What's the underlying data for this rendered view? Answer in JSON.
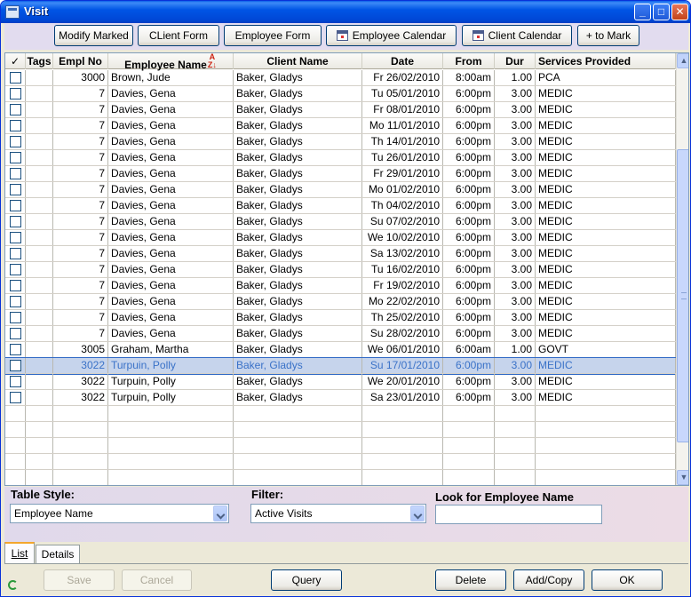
{
  "window": {
    "title": "Visit"
  },
  "toolbar": {
    "modify_marked": "Modify Marked",
    "client_form": "CLient Form",
    "employee_form": "Employee Form",
    "employee_calendar": "Employee Calendar",
    "client_calendar": "Client Calendar",
    "to_mark": "+ to Mark"
  },
  "table": {
    "headers": {
      "check": "✓",
      "tags": "Tags",
      "empl_no": "Empl No",
      "employee_name": "Employee Name",
      "client_name": "Client Name",
      "date": "Date",
      "from": "From",
      "dur": "Dur",
      "services": "Services Provided"
    },
    "rows": [
      {
        "empl": "3000",
        "employee": "Brown, Jude",
        "client": "Baker, Gladys",
        "date": "Fr 26/02/2010",
        "from": "8:00am",
        "dur": "1.00",
        "service": "PCA"
      },
      {
        "empl": "7",
        "employee": "Davies, Gena",
        "client": "Baker, Gladys",
        "date": "Tu 05/01/2010",
        "from": "6:00pm",
        "dur": "3.00",
        "service": "MEDIC"
      },
      {
        "empl": "7",
        "employee": "Davies, Gena",
        "client": "Baker, Gladys",
        "date": "Fr 08/01/2010",
        "from": "6:00pm",
        "dur": "3.00",
        "service": "MEDIC"
      },
      {
        "empl": "7",
        "employee": "Davies, Gena",
        "client": "Baker, Gladys",
        "date": "Mo 11/01/2010",
        "from": "6:00pm",
        "dur": "3.00",
        "service": "MEDIC"
      },
      {
        "empl": "7",
        "employee": "Davies, Gena",
        "client": "Baker, Gladys",
        "date": "Th 14/01/2010",
        "from": "6:00pm",
        "dur": "3.00",
        "service": "MEDIC"
      },
      {
        "empl": "7",
        "employee": "Davies, Gena",
        "client": "Baker, Gladys",
        "date": "Tu 26/01/2010",
        "from": "6:00pm",
        "dur": "3.00",
        "service": "MEDIC"
      },
      {
        "empl": "7",
        "employee": "Davies, Gena",
        "client": "Baker, Gladys",
        "date": "Fr 29/01/2010",
        "from": "6:00pm",
        "dur": "3.00",
        "service": "MEDIC"
      },
      {
        "empl": "7",
        "employee": "Davies, Gena",
        "client": "Baker, Gladys",
        "date": "Mo 01/02/2010",
        "from": "6:00pm",
        "dur": "3.00",
        "service": "MEDIC"
      },
      {
        "empl": "7",
        "employee": "Davies, Gena",
        "client": "Baker, Gladys",
        "date": "Th 04/02/2010",
        "from": "6:00pm",
        "dur": "3.00",
        "service": "MEDIC"
      },
      {
        "empl": "7",
        "employee": "Davies, Gena",
        "client": "Baker, Gladys",
        "date": "Su 07/02/2010",
        "from": "6:00pm",
        "dur": "3.00",
        "service": "MEDIC"
      },
      {
        "empl": "7",
        "employee": "Davies, Gena",
        "client": "Baker, Gladys",
        "date": "We 10/02/2010",
        "from": "6:00pm",
        "dur": "3.00",
        "service": "MEDIC"
      },
      {
        "empl": "7",
        "employee": "Davies, Gena",
        "client": "Baker, Gladys",
        "date": "Sa 13/02/2010",
        "from": "6:00pm",
        "dur": "3.00",
        "service": "MEDIC"
      },
      {
        "empl": "7",
        "employee": "Davies, Gena",
        "client": "Baker, Gladys",
        "date": "Tu 16/02/2010",
        "from": "6:00pm",
        "dur": "3.00",
        "service": "MEDIC"
      },
      {
        "empl": "7",
        "employee": "Davies, Gena",
        "client": "Baker, Gladys",
        "date": "Fr 19/02/2010",
        "from": "6:00pm",
        "dur": "3.00",
        "service": "MEDIC"
      },
      {
        "empl": "7",
        "employee": "Davies, Gena",
        "client": "Baker, Gladys",
        "date": "Mo 22/02/2010",
        "from": "6:00pm",
        "dur": "3.00",
        "service": "MEDIC"
      },
      {
        "empl": "7",
        "employee": "Davies, Gena",
        "client": "Baker, Gladys",
        "date": "Th 25/02/2010",
        "from": "6:00pm",
        "dur": "3.00",
        "service": "MEDIC"
      },
      {
        "empl": "7",
        "employee": "Davies, Gena",
        "client": "Baker, Gladys",
        "date": "Su 28/02/2010",
        "from": "6:00pm",
        "dur": "3.00",
        "service": "MEDIC"
      },
      {
        "empl": "3005",
        "employee": "Graham, Martha",
        "client": "Baker, Gladys",
        "date": "We 06/01/2010",
        "from": "6:00am",
        "dur": "1.00",
        "service": "GOVT"
      },
      {
        "empl": "3022",
        "employee": "Turpuin, Polly",
        "client": "Baker, Gladys",
        "date": "Su 17/01/2010",
        "from": "6:00pm",
        "dur": "3.00",
        "service": "MEDIC",
        "selected": true
      },
      {
        "empl": "3022",
        "employee": "Turpuin, Polly",
        "client": "Baker, Gladys",
        "date": "We 20/01/2010",
        "from": "6:00pm",
        "dur": "3.00",
        "service": "MEDIC"
      },
      {
        "empl": "3022",
        "employee": "Turpuin, Polly",
        "client": "Baker, Gladys",
        "date": "Sa 23/01/2010",
        "from": "6:00pm",
        "dur": "3.00",
        "service": "MEDIC"
      }
    ]
  },
  "filters": {
    "table_style_label": "Table Style:",
    "table_style_value": "Employee Name",
    "filter_label": "Filter:",
    "filter_value": "Active Visits",
    "look_for_label": "Look for Employee Name",
    "look_for_value": ""
  },
  "tabs": {
    "list": "List",
    "details": "Details"
  },
  "footer": {
    "save": "Save",
    "cancel": "Cancel",
    "query": "Query",
    "delete": "Delete",
    "add_copy": "Add/Copy",
    "ok": "OK"
  },
  "colors": {
    "titlebar": "#0055e5",
    "selected_row": "#c6d4ec",
    "toolbar_bg": "#e2dcef"
  }
}
